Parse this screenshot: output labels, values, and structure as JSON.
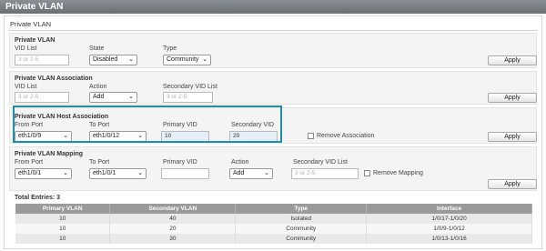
{
  "page_title": "Private VLAN",
  "section_title": "Private VLAN",
  "pvlan": {
    "title": "Private VLAN",
    "vid_list_label": "VID List",
    "vid_list_placeholder": "3 or 2-5",
    "state_label": "State",
    "state_value": "Disabled",
    "type_label": "Type",
    "type_value": "Community",
    "apply_label": "Apply"
  },
  "assoc": {
    "title": "Private VLAN Association",
    "vid_list_label": "VID List",
    "vid_list_placeholder": "3 or 2-5",
    "action_label": "Action",
    "action_value": "Add",
    "secondary_label": "Secondary VID List",
    "secondary_placeholder": "3 or 2-5",
    "apply_label": "Apply"
  },
  "host": {
    "title": "Private VLAN Host Association",
    "from_port_label": "From Port",
    "from_port_value": "eth1/0/9",
    "to_port_label": "To Port",
    "to_port_value": "eth1/0/12",
    "primary_label": "Primary VID",
    "primary_value": "10",
    "secondary_label": "Secondary VID",
    "secondary_value": "20",
    "remove_label": "Remove Association",
    "apply_label": "Apply"
  },
  "mapping": {
    "title": "Private VLAN Mapping",
    "from_port_label": "From Port",
    "from_port_value": "eth1/0/1",
    "to_port_label": "To Port",
    "to_port_value": "eth1/0/1",
    "primary_label": "Primary VID",
    "action_label": "Action",
    "action_value": "Add",
    "secondary_label": "Secondary VID List",
    "secondary_placeholder": "3 or 2-5",
    "remove_label": "Remove Mapping",
    "apply_label": "Apply"
  },
  "table": {
    "total_label": "Total Entries: 3",
    "headers": [
      "Primary VLAN",
      "Secondary VLAN",
      "Type",
      "Interface"
    ],
    "rows": [
      [
        "10",
        "40",
        "Isolated",
        "1/0/17-1/0/20"
      ],
      [
        "10",
        "20",
        "Community",
        "1/0/9-1/0/12"
      ],
      [
        "10",
        "30",
        "Community",
        "1/0/13-1/0/16"
      ]
    ]
  }
}
